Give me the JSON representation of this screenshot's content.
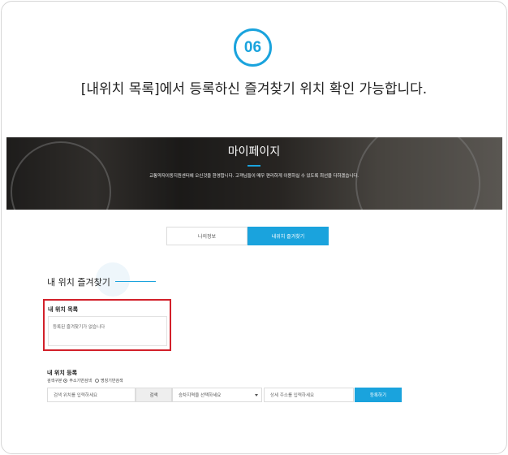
{
  "step": {
    "number": "06",
    "caption": "[내위치 목록]에서 등록하신 즐겨찾기 위치 확인 가능합니다."
  },
  "hero": {
    "title": "마이페이지",
    "subtitle": "교통약자이동지원센터에 오신것을 환영합니다. 고객님들이 매우 편리하게 이용하실 수 있도록 최선을 다하겠습니다."
  },
  "tabs": [
    {
      "label": "나의정보",
      "active": false
    },
    {
      "label": "내위치 즐겨찾기",
      "active": true
    }
  ],
  "section": {
    "title": "내 위치 즐겨찾기"
  },
  "location_list": {
    "label": "내 위치 목록",
    "empty_text": "등록된 즐겨찾기가 없습니다"
  },
  "registration": {
    "label": "내 위치 등록",
    "search_type_label": "검색구분",
    "radio_options": [
      {
        "label": "주소기반검색",
        "selected": true
      },
      {
        "label": "명칭기반검색",
        "selected": false
      }
    ],
    "location_placeholder": "검색 위치를 입력하세요",
    "search_button": "검색",
    "select_value": "승차지역을 선택하세요",
    "address_placeholder": "상세 주소를 입력하세요",
    "register_button": "등록하기"
  },
  "colors": {
    "accent": "#1aa3dd",
    "highlight": "#d2202a"
  }
}
